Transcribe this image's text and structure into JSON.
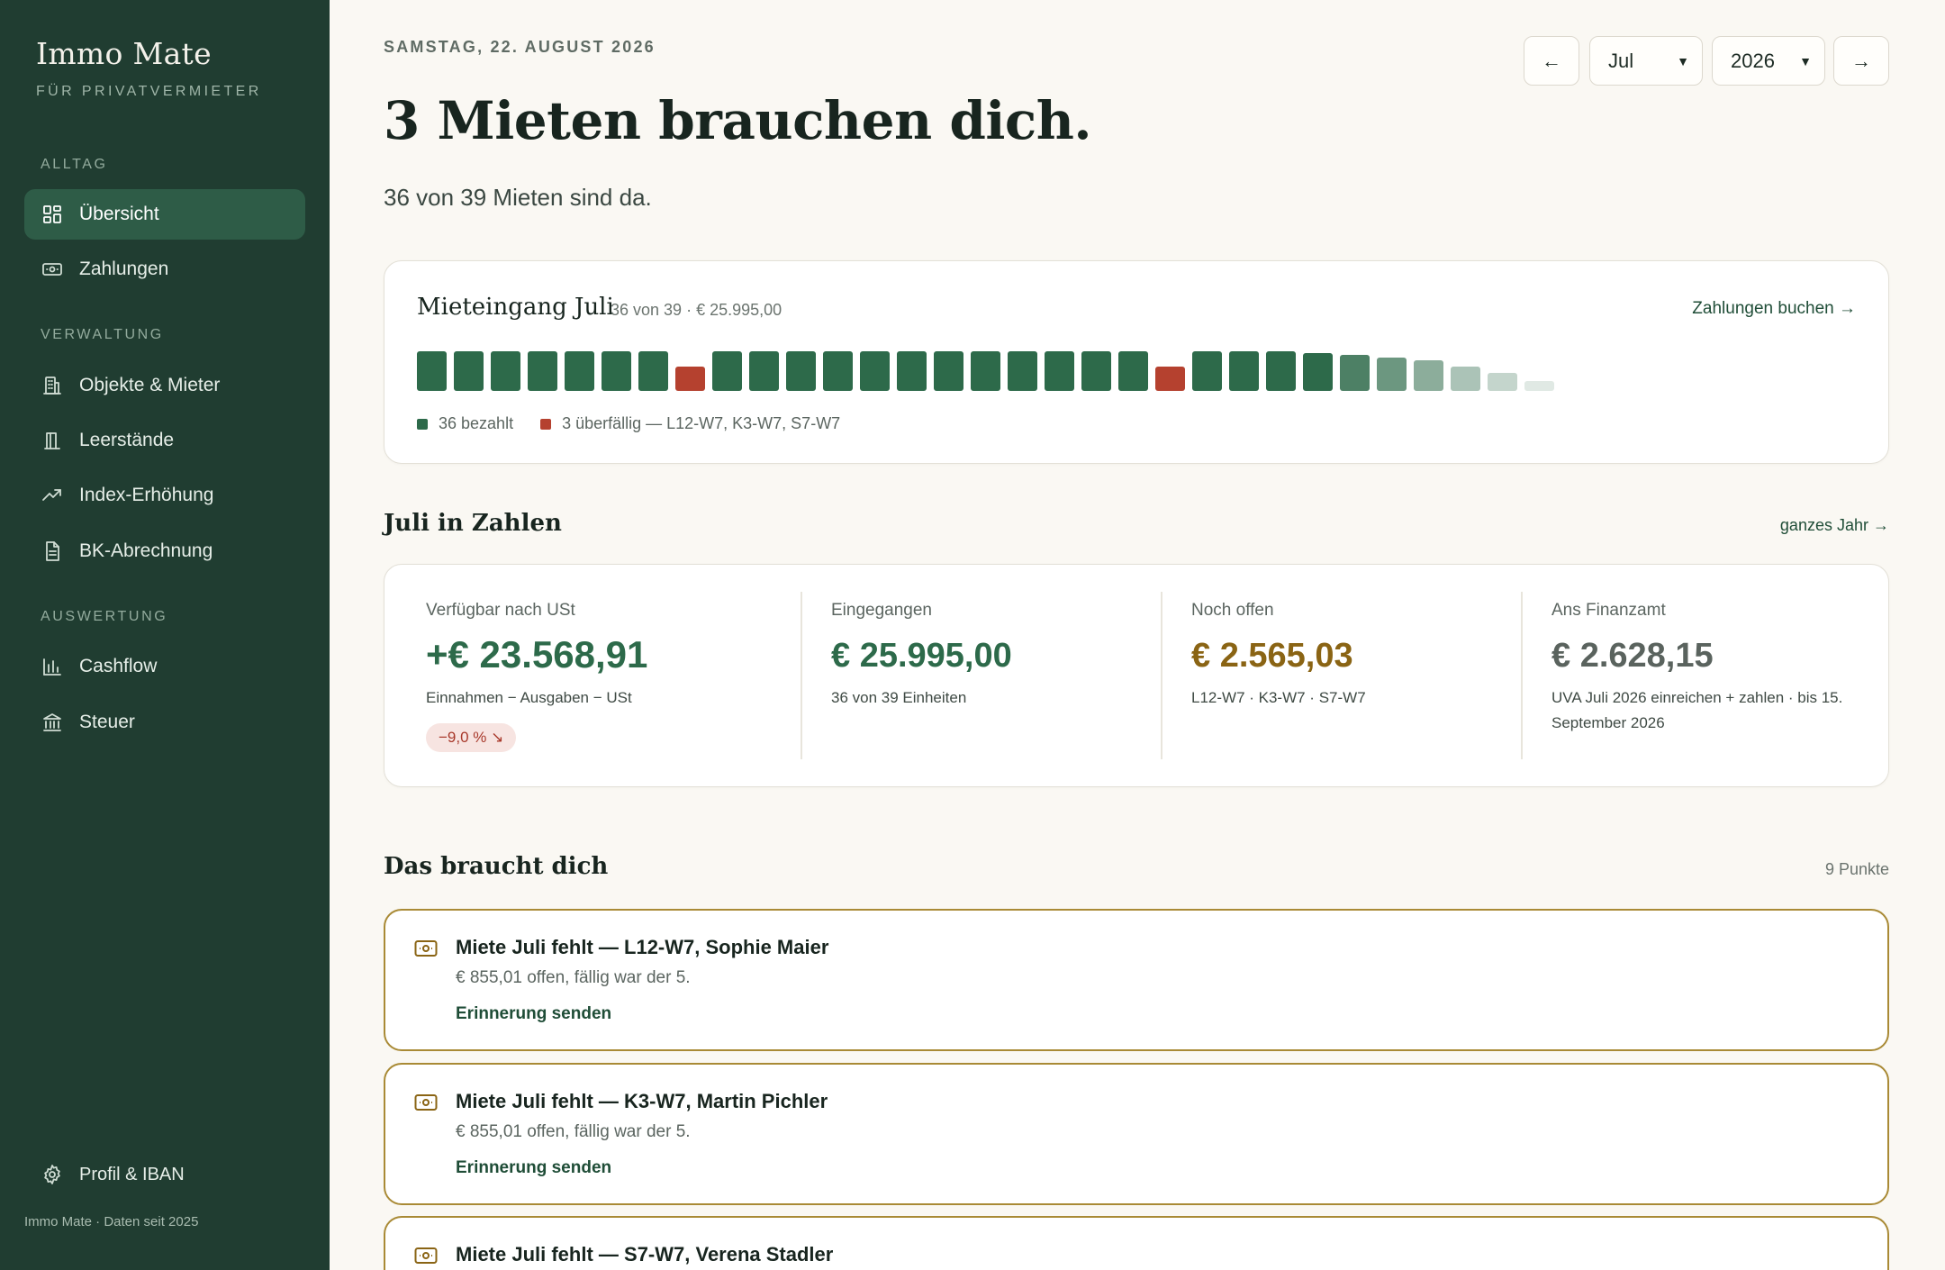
{
  "app": {
    "name": "Immo Mate",
    "tagline": "FÜR PRIVATVERMIETER",
    "footer": "Immo Mate · Daten seit 2025",
    "accent": "#203d31"
  },
  "sidebar": {
    "sections": [
      {
        "title": "ALLTAG",
        "items": [
          {
            "label": "Übersicht",
            "icon": "dashboard-icon",
            "active": true
          },
          {
            "label": "Zahlungen",
            "icon": "money-icon"
          }
        ]
      },
      {
        "title": "VERWALTUNG",
        "items": [
          {
            "label": "Objekte & Mieter",
            "icon": "building-icon"
          },
          {
            "label": "Leerstände",
            "icon": "door-icon"
          },
          {
            "label": "Index-Erhöhung",
            "icon": "trend-up-icon"
          },
          {
            "label": "BK-Abrechnung",
            "icon": "document-icon"
          }
        ]
      },
      {
        "title": "AUSWERTUNG",
        "items": [
          {
            "label": "Cashflow",
            "icon": "bar-chart-icon"
          },
          {
            "label": "Steuer",
            "icon": "bank-icon"
          }
        ]
      }
    ],
    "profile": {
      "label": "Profil & IBAN",
      "icon": "gear-icon"
    }
  },
  "header": {
    "date": "SAMSTAG, 22. AUGUST 2026",
    "headline": "3 Mieten brauchen dich.",
    "subline": "36 von 39 Mieten sind da.",
    "prev_label": "←",
    "next_label": "→",
    "month": "Jul",
    "year": "2026"
  },
  "rent_intake": {
    "title": "Mieteingang Juli",
    "meta": "36 von 39 · € 25.995,00",
    "link": "Zahlungen buchen",
    "legend_paid": "36 bezahlt",
    "legend_overdue": "3 überfällig — L12-W7, K3-W7, S7-W7",
    "colors": {
      "paid": "#2d6a4a",
      "overdue": "#b5412f"
    },
    "units": [
      {
        "status": "paid",
        "level": 1
      },
      {
        "status": "paid",
        "level": 1
      },
      {
        "status": "paid",
        "level": 1
      },
      {
        "status": "paid",
        "level": 1
      },
      {
        "status": "paid",
        "level": 1
      },
      {
        "status": "paid",
        "level": 1
      },
      {
        "status": "paid",
        "level": 1
      },
      {
        "status": "overdue",
        "level": 0.62
      },
      {
        "status": "paid",
        "level": 1
      },
      {
        "status": "paid",
        "level": 1
      },
      {
        "status": "paid",
        "level": 1
      },
      {
        "status": "paid",
        "level": 1
      },
      {
        "status": "paid",
        "level": 1
      },
      {
        "status": "paid",
        "level": 1
      },
      {
        "status": "paid",
        "level": 1
      },
      {
        "status": "paid",
        "level": 1
      },
      {
        "status": "paid",
        "level": 1
      },
      {
        "status": "paid",
        "level": 1
      },
      {
        "status": "paid",
        "level": 1
      },
      {
        "status": "paid",
        "level": 1
      },
      {
        "status": "overdue",
        "level": 0.62
      },
      {
        "status": "paid",
        "level": 1
      },
      {
        "status": "paid",
        "level": 1
      },
      {
        "status": "paid",
        "level": 1
      },
      {
        "status": "paid",
        "level": 0.95
      },
      {
        "status": "paid",
        "level": 0.92,
        "shade": 0.85
      },
      {
        "status": "paid",
        "level": 0.85,
        "shade": 0.7
      },
      {
        "status": "paid",
        "level": 0.78,
        "shade": 0.55
      },
      {
        "status": "paid",
        "level": 0.62,
        "shade": 0.4
      },
      {
        "status": "paid",
        "level": 0.45,
        "shade": 0.28
      },
      {
        "status": "paid",
        "level": 0.24,
        "shade": 0.15
      }
    ]
  },
  "stats": {
    "title": "Juli in Zahlen",
    "link": "ganzes Jahr",
    "items": [
      {
        "label": "Verfügbar nach USt",
        "value": "+€ 23.568,91",
        "note": "Einnahmen − Ausgaben − USt",
        "badge": "−9,0 % ↘",
        "color": "#2d6a4a"
      },
      {
        "label": "Eingegangen",
        "value": "€ 25.995,00",
        "note": "36 von 39 Einheiten",
        "color": "#2d6a4a"
      },
      {
        "label": "Noch offen",
        "value": "€ 2.565,03",
        "note": "L12-W7 · K3-W7 · S7-W7",
        "color": "#8a6414"
      },
      {
        "label": "Ans Finanzamt",
        "value": "€ 2.628,15",
        "note": "UVA Juli 2026 einreichen + zahlen · bis 15. September 2026",
        "color": "#5a635e"
      }
    ]
  },
  "tasks": {
    "title": "Das braucht dich",
    "count": "9 Punkte",
    "items": [
      {
        "title": "Miete Juli fehlt — L12-W7, Sophie Maier",
        "desc": "€ 855,01 offen, fällig war der 5.",
        "action": "Erinnerung senden"
      },
      {
        "title": "Miete Juli fehlt — K3-W7, Martin Pichler",
        "desc": "€ 855,01 offen, fällig war der 5.",
        "action": "Erinnerung senden"
      },
      {
        "title": "Miete Juli fehlt — S7-W7, Verena Stadler",
        "desc": "",
        "action": ""
      }
    ]
  }
}
